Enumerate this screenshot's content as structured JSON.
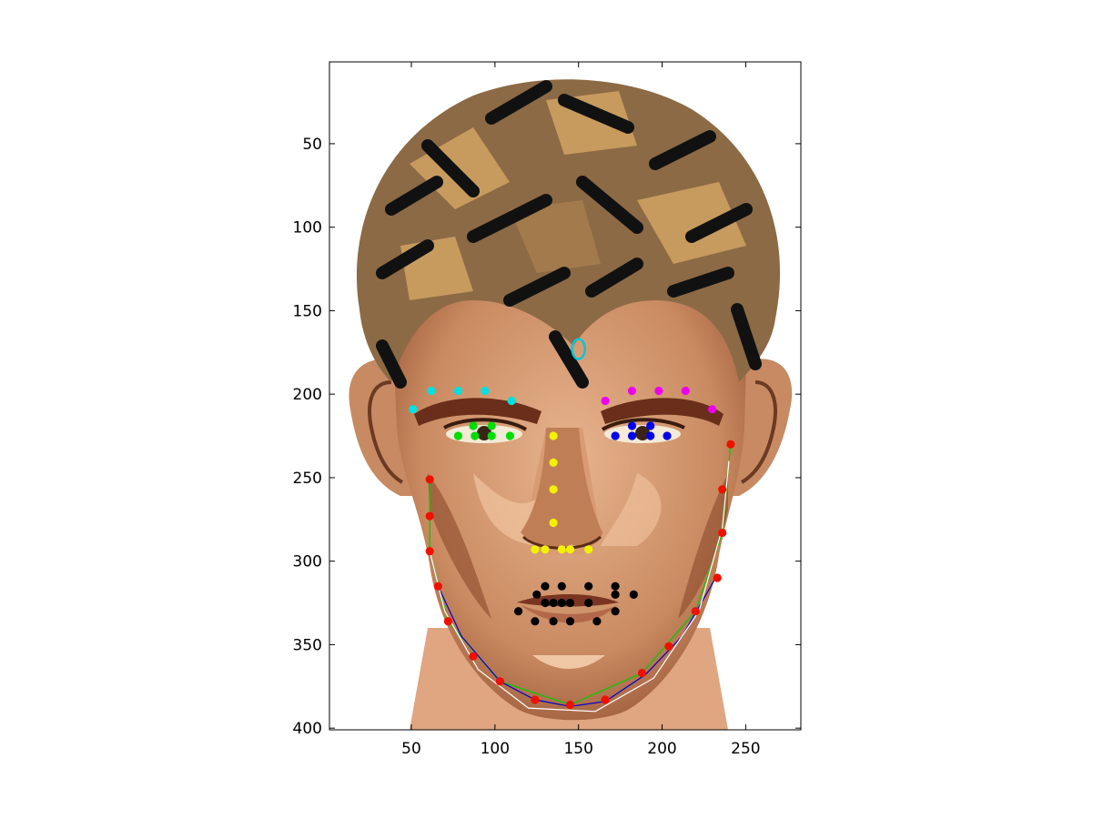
{
  "chart_data": {
    "type": "scatter",
    "title": "",
    "xlabel": "",
    "ylabel": "",
    "xlim": [
      1,
      283
    ],
    "ylim": [
      401,
      1
    ],
    "y_reversed": true,
    "grid": false,
    "x_ticks": [
      50,
      100,
      150,
      200,
      250
    ],
    "y_ticks": [
      50,
      100,
      150,
      200,
      250,
      300,
      350,
      400
    ],
    "background_image": "cartoon-male-face",
    "point_series": [
      {
        "name": "",
        "color": "#00e0e0",
        "marker": "dot",
        "points": [
          [
            51,
            209
          ],
          [
            62,
            198
          ],
          [
            78,
            198
          ],
          [
            94,
            198
          ],
          [
            110,
            204
          ]
        ]
      },
      {
        "name": "",
        "color": "#ee00ee",
        "marker": "dot",
        "points": [
          [
            166,
            204
          ],
          [
            182,
            198
          ],
          [
            198,
            198
          ],
          [
            214,
            198
          ],
          [
            230,
            209
          ]
        ]
      },
      {
        "name": "",
        "color": "#00dd00",
        "marker": "dot",
        "points": [
          [
            78,
            225
          ],
          [
            88,
            225
          ],
          [
            98,
            225
          ],
          [
            109,
            225
          ],
          [
            87,
            219
          ],
          [
            98,
            219
          ]
        ]
      },
      {
        "name": "",
        "color": "#0000ee",
        "marker": "dot",
        "points": [
          [
            172,
            225
          ],
          [
            182,
            225
          ],
          [
            193,
            225
          ],
          [
            203,
            225
          ],
          [
            182,
            219
          ],
          [
            193,
            219
          ]
        ]
      },
      {
        "name": "",
        "color": "#f2f200",
        "marker": "dot",
        "points": [
          [
            135,
            225
          ],
          [
            135,
            241
          ],
          [
            135,
            257
          ],
          [
            135,
            277
          ],
          [
            124,
            293
          ],
          [
            130,
            293
          ],
          [
            140,
            293
          ],
          [
            145,
            293
          ],
          [
            156,
            293
          ]
        ]
      },
      {
        "name": "",
        "color": "#000000",
        "marker": "dot",
        "points": [
          [
            130,
            315
          ],
          [
            140,
            315
          ],
          [
            156,
            315
          ],
          [
            172,
            315
          ],
          [
            125,
            320
          ],
          [
            130,
            325
          ],
          [
            135,
            325
          ],
          [
            140,
            325
          ],
          [
            145,
            325
          ],
          [
            156,
            325
          ],
          [
            172,
            320
          ],
          [
            183,
            320
          ],
          [
            114,
            330
          ],
          [
            124,
            336
          ],
          [
            135,
            336
          ],
          [
            145,
            336
          ],
          [
            161,
            336
          ],
          [
            172,
            330
          ]
        ]
      },
      {
        "name": "",
        "color": "#ee1100",
        "marker": "dot",
        "points": [
          [
            61,
            251
          ],
          [
            61,
            273
          ],
          [
            61,
            294
          ],
          [
            66,
            315
          ],
          [
            72,
            336
          ],
          [
            87,
            357
          ],
          [
            103,
            372
          ],
          [
            124,
            383
          ],
          [
            145,
            386
          ],
          [
            166,
            383
          ],
          [
            188,
            367
          ],
          [
            204,
            351
          ],
          [
            220,
            330
          ],
          [
            233,
            310
          ],
          [
            236,
            283
          ],
          [
            236,
            257
          ],
          [
            241,
            230
          ]
        ]
      }
    ],
    "curves": [
      {
        "name": "",
        "color": "#00cc00",
        "points": [
          [
            61,
            251
          ],
          [
            61,
            294
          ],
          [
            72,
            336
          ],
          [
            103,
            372
          ],
          [
            145,
            386
          ],
          [
            188,
            367
          ],
          [
            220,
            330
          ],
          [
            236,
            283
          ],
          [
            241,
            230
          ]
        ]
      },
      {
        "name": "",
        "color": "#0000cc",
        "points": [
          [
            66,
            315
          ],
          [
            80,
            345
          ],
          [
            103,
            372
          ],
          [
            124,
            383
          ],
          [
            145,
            387
          ],
          [
            166,
            384
          ],
          [
            190,
            368
          ],
          [
            212,
            345
          ],
          [
            232,
            310
          ]
        ]
      },
      {
        "name": "",
        "color": "#ffffff",
        "points": [
          [
            61,
            294
          ],
          [
            70,
            330
          ],
          [
            90,
            365
          ],
          [
            120,
            388
          ],
          [
            160,
            390
          ],
          [
            195,
            370
          ],
          [
            222,
            330
          ],
          [
            236,
            280
          ],
          [
            240,
            240
          ]
        ]
      }
    ],
    "markers": [
      {
        "name": "",
        "color": "#00c8d8",
        "marker": "ellipse",
        "x": 150,
        "y": 173
      }
    ]
  }
}
